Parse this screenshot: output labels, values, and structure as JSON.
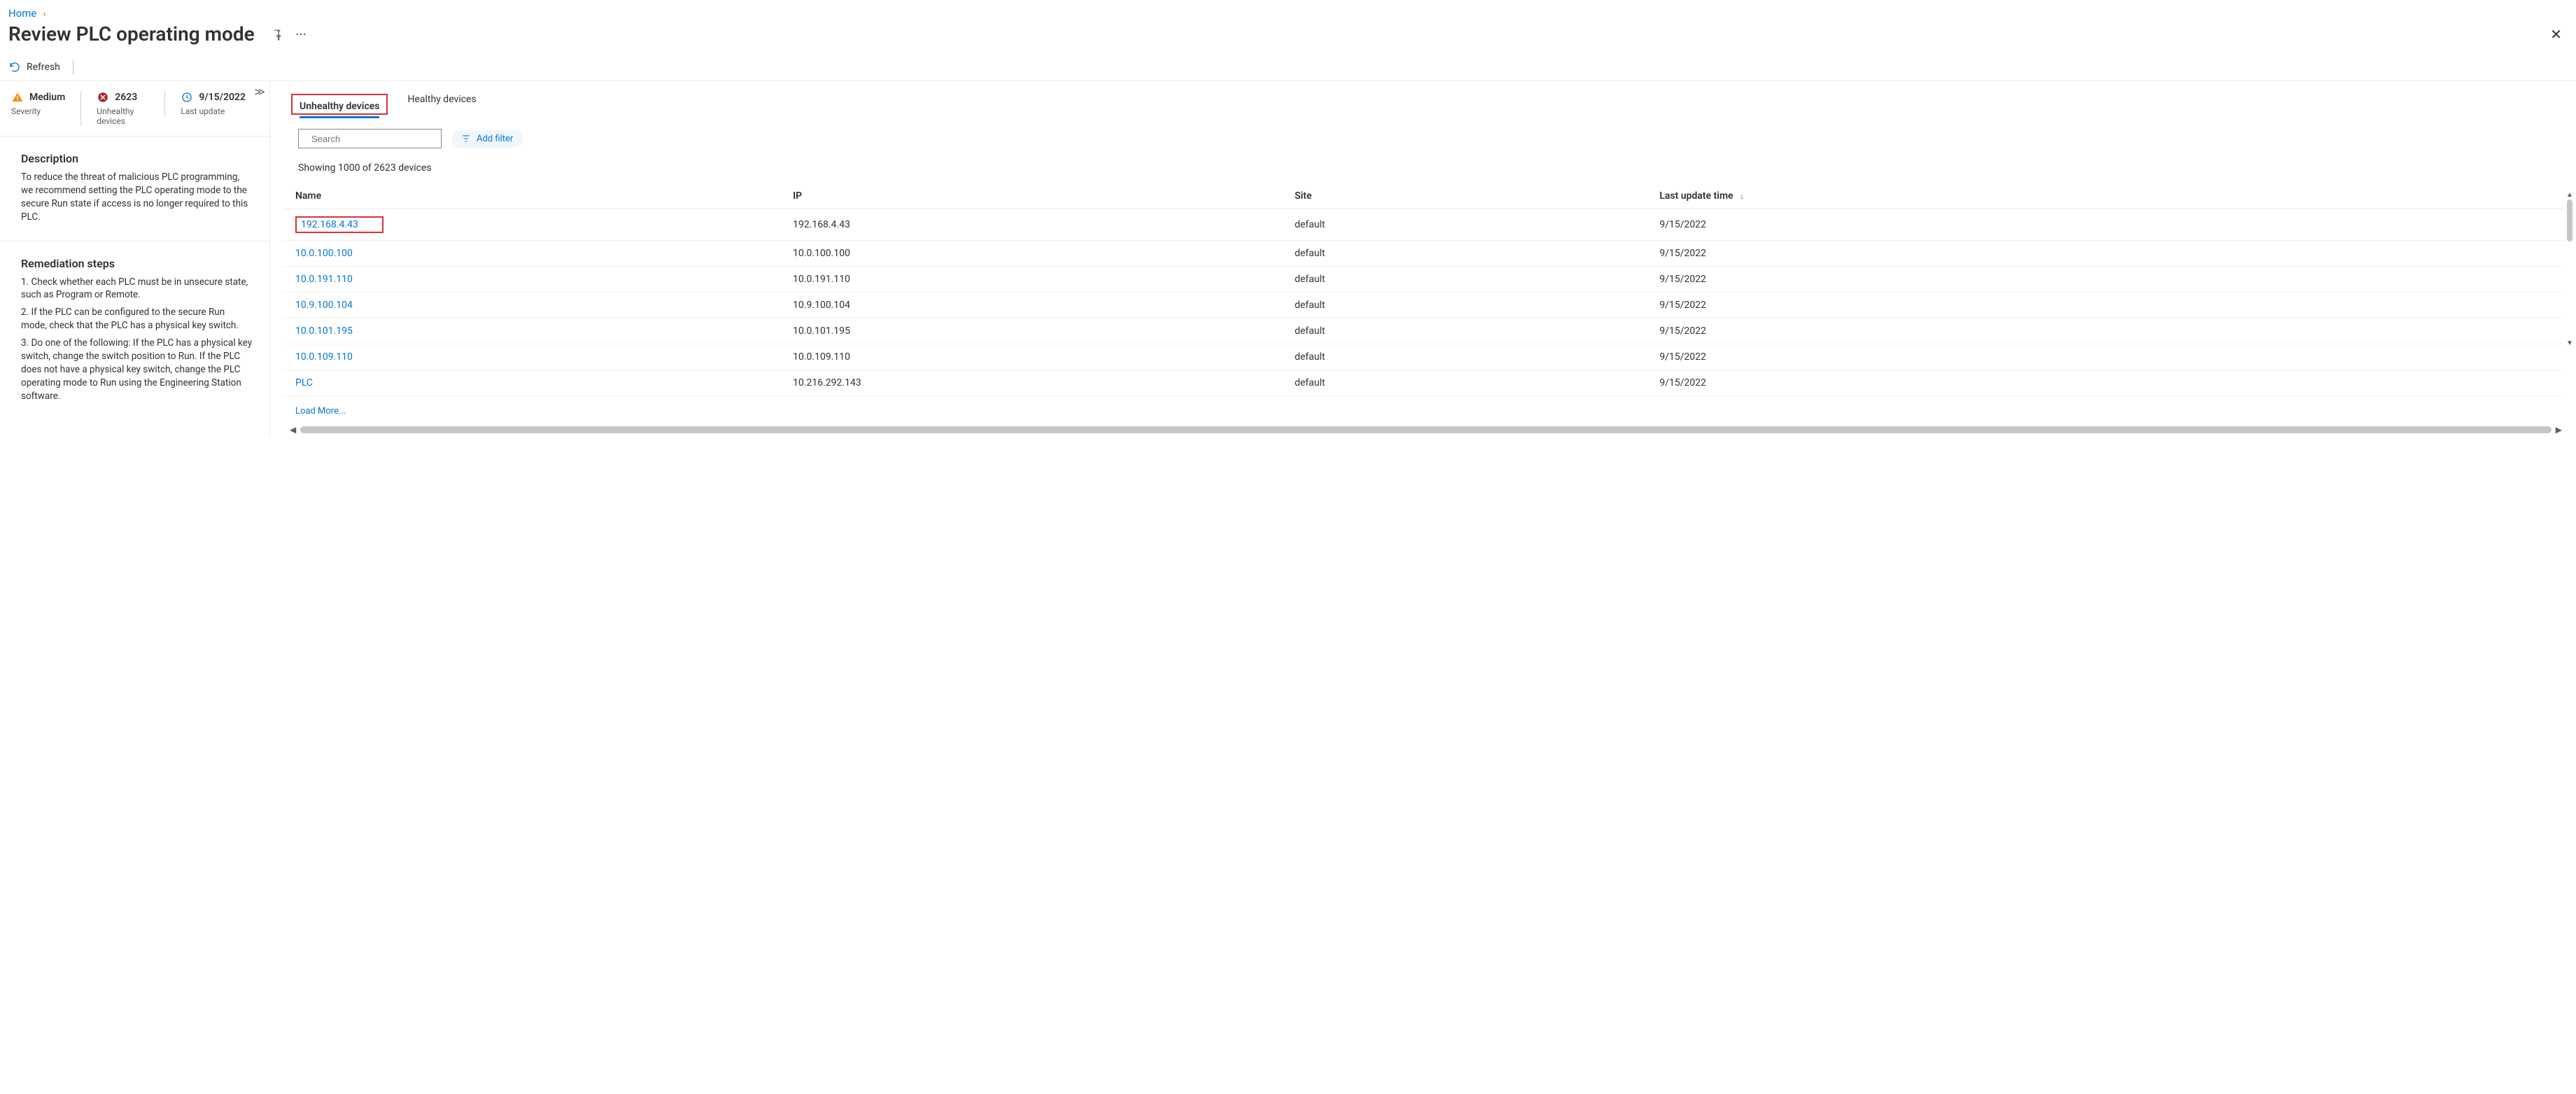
{
  "breadcrumb": {
    "home": "Home"
  },
  "title": "Review PLC operating mode",
  "commands": {
    "refresh": "Refresh"
  },
  "summary": {
    "severity": {
      "value": "Medium",
      "label": "Severity"
    },
    "unhealthy": {
      "value": "2623",
      "label": "Unhealthy devices"
    },
    "last_update": {
      "value": "9/15/2022",
      "label": "Last update"
    }
  },
  "description": {
    "heading": "Description",
    "body": "To reduce the threat of malicious PLC programming, we recommend setting the PLC operating mode to the secure Run state if access is no longer required to this PLC."
  },
  "remediation": {
    "heading": "Remediation steps",
    "step1": "1. Check whether each PLC must be in unsecure state, such as Program or Remote.",
    "step2": "2. If the PLC can be configured to the secure Run mode, check that the PLC has a physical key switch.",
    "step3": "3. Do one of the following: If the PLC has a physical key switch, change the switch position to Run. If the PLC does not have a physical key switch, change the PLC operating mode to Run using the Engineering Station software."
  },
  "tabs": {
    "unhealthy": "Unhealthy devices",
    "healthy": "Healthy devices"
  },
  "search": {
    "placeholder": "Search"
  },
  "add_filter": "Add filter",
  "count_line": "Showing 1000 of 2623 devices",
  "columns": {
    "name": "Name",
    "ip": "IP",
    "site": "Site",
    "last_update": "Last update time"
  },
  "rows": [
    {
      "name": "192.168.4.43",
      "ip": "192.168.4.43",
      "site": "default",
      "last_update": "9/15/2022"
    },
    {
      "name": "10.0.100.100",
      "ip": "10.0.100.100",
      "site": "default",
      "last_update": "9/15/2022"
    },
    {
      "name": "10.0.191.110",
      "ip": "10.0.191.110",
      "site": "default",
      "last_update": "9/15/2022"
    },
    {
      "name": "10.9.100.104",
      "ip": "10.9.100.104",
      "site": "default",
      "last_update": "9/15/2022"
    },
    {
      "name": "10.0.101.195",
      "ip": "10.0.101.195",
      "site": "default",
      "last_update": "9/15/2022"
    },
    {
      "name": "10.0.109.110",
      "ip": "10.0.109.110",
      "site": "default",
      "last_update": "9/15/2022"
    },
    {
      "name": "PLC",
      "ip": "10.216.292.143",
      "site": "default",
      "last_update": "9/15/2022"
    }
  ],
  "load_more": "Load More..."
}
